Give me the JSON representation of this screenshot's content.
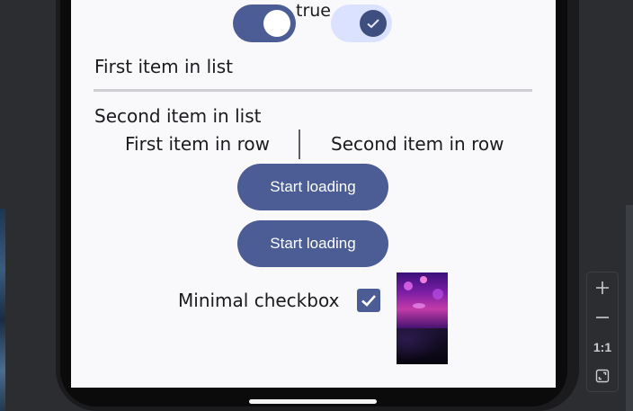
{
  "switches": {
    "first_checked": true,
    "label": "true",
    "second_checked": true
  },
  "list": {
    "first_item": "First item in list",
    "second_item": "Second item in list"
  },
  "row": {
    "first_item": "First item in row",
    "second_item": "Second item in row"
  },
  "buttons": {
    "start_loading_1": "Start loading",
    "start_loading_2": "Start loading"
  },
  "checkbox": {
    "label": "Minimal checkbox",
    "checked": true
  },
  "zoom_controls": {
    "zoom_in_icon": "plus-icon",
    "zoom_out_icon": "minus-icon",
    "actual_size_label": "1:1",
    "fit_screen_icon": "fit-screen-icon"
  },
  "colors": {
    "primary": "#4c5d95",
    "primary_container": "#dae2ff",
    "surface": "#f9f9fb",
    "on_surface": "#1b1b1f"
  }
}
